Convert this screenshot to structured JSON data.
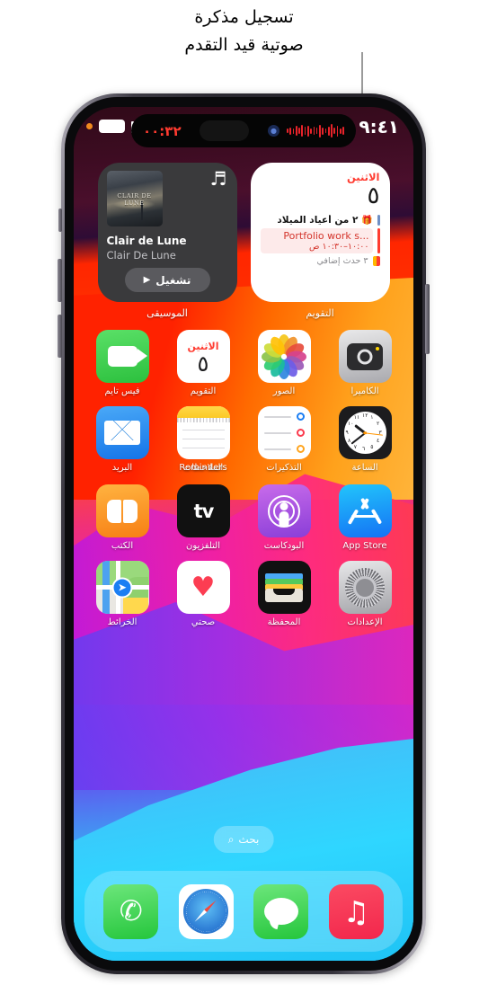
{
  "annotation": {
    "line1": "تسجيل مذكرة",
    "line2": "صوتية قيد التقدم"
  },
  "status_bar": {
    "time": "٩:٤١",
    "recording_dot": "orange-recording-dot",
    "battery_icon": "battery-icon",
    "equalizer_icon": "audio-levels-icon"
  },
  "dynamic_island": {
    "timer": "٠٠:٣٢",
    "app_icon": "voice-memos-icon",
    "waveform_icon": "recording-waveform-icon",
    "waveform_color": "#e8232a"
  },
  "widgets": [
    {
      "name": "calendar",
      "label": "التقويم",
      "day_of_week": "الاثنين",
      "day_number": "٥",
      "events": [
        {
          "title": "٢ من أعياد الميلاد",
          "time": "",
          "icon": "gift-icon",
          "bar": "blue"
        },
        {
          "title": "Portfolio work s...",
          "time": "١٠:٠٠–١٠:٣٠ ص",
          "icon": "",
          "bar": "red"
        },
        {
          "title": "٣ حدث إضافي",
          "time": "",
          "icon": "",
          "bar": "double"
        }
      ]
    },
    {
      "name": "music",
      "label": "الموسيقى",
      "track_title": "Clair de Lune",
      "track_subtitle": "Clair De Lune",
      "artwork_caption": "CLAIR DE LUNE",
      "play_label": "تشغيل",
      "note_icon": "music-note-icon",
      "play_icon": "play-triangle-icon"
    }
  ],
  "app_grid": [
    [
      {
        "label": "الكاميرا",
        "icon": "camera-icon",
        "ltr": false
      },
      {
        "label": "الصور",
        "icon": "photos-icon",
        "ltr": false
      },
      {
        "label": "التقويم",
        "icon": "calendar-icon",
        "ltr": false,
        "badge_dow": "الاثنين",
        "badge_day": "٥"
      },
      {
        "label": "فيس تايم",
        "icon": "facetime-icon",
        "ltr": false
      }
    ],
    [
      {
        "label": "الساعة",
        "icon": "clock-icon",
        "ltr": false
      },
      {
        "label": "التذكيرات",
        "icon": "reminders-icon",
        "ltr": false
      },
      {
        "label": "الملاحظات",
        "label_overlay": "Reminders",
        "icon": "notes-icon",
        "ltr": false
      },
      {
        "label": "البريد",
        "icon": "mail-icon",
        "ltr": false
      }
    ],
    [
      {
        "label": "App Store",
        "icon": "app-store-icon",
        "ltr": true
      },
      {
        "label": "البودكاست",
        "icon": "podcasts-icon",
        "ltr": false
      },
      {
        "label": "التلفزيون",
        "icon": "tv-icon",
        "ltr": false
      },
      {
        "label": "الكتب",
        "icon": "books-icon",
        "ltr": false
      }
    ],
    [
      {
        "label": "الإعدادات",
        "icon": "settings-icon",
        "ltr": false
      },
      {
        "label": "المحفظة",
        "icon": "wallet-icon",
        "ltr": false
      },
      {
        "label": "صحتي",
        "icon": "health-icon",
        "ltr": false
      },
      {
        "label": "الخرائط",
        "icon": "maps-icon",
        "ltr": false
      }
    ]
  ],
  "search": {
    "label": "بحث",
    "icon": "search-magnifier-icon"
  },
  "dock": [
    {
      "label": "الموسيقى",
      "icon": "music-app-icon"
    },
    {
      "label": "الرسائل",
      "icon": "messages-app-icon"
    },
    {
      "label": "سفاري",
      "icon": "safari-app-icon"
    },
    {
      "label": "الهاتف",
      "icon": "phone-app-icon"
    }
  ],
  "colors": {
    "accent_red": "#ff3b30",
    "wallpaper_top": "#2a0a14",
    "wallpaper_mid": "#ff2a00",
    "wallpaper_magenta": "#e81fc0",
    "wallpaper_bottom": "#2fd0ff"
  }
}
